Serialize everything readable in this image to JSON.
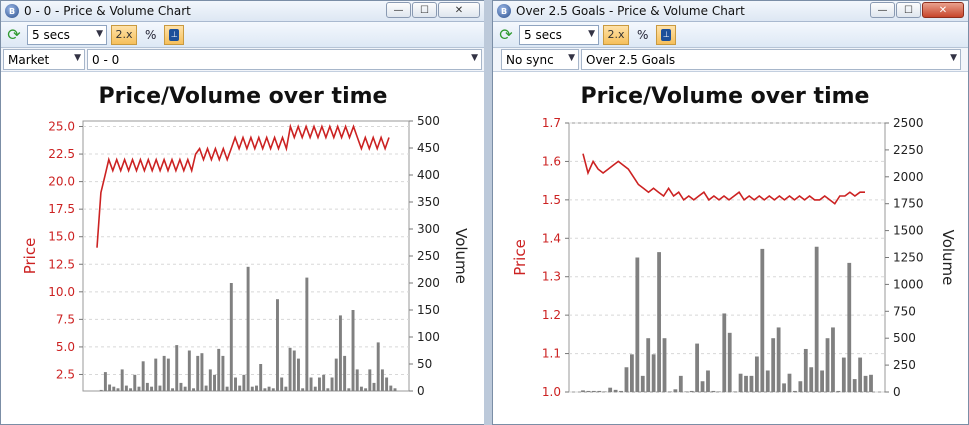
{
  "windows": [
    {
      "title": "0 - 0 - Price & Volume Chart",
      "window_buttons": {
        "minimize": "—",
        "maximize": "☐",
        "close": "✕"
      },
      "close_active": false,
      "toolbar": {
        "refresh_icon": "refresh-icon",
        "interval": "5 secs",
        "zoom": "2.x",
        "percent": "%",
        "pin_icon": "pin-icon"
      },
      "market_select": "Market",
      "runner_select": "0 - 0"
    },
    {
      "title": "Over 2.5 Goals - Price & Volume Chart",
      "window_buttons": {
        "minimize": "—",
        "maximize": "☐",
        "close": "✕"
      },
      "close_active": true,
      "toolbar": {
        "refresh_icon": "refresh-icon",
        "interval": "5 secs",
        "zoom": "2.x",
        "percent": "%",
        "pin_icon": "pin-icon"
      },
      "market_select": "No sync",
      "runner_select": "Over 2.5 Goals"
    }
  ],
  "chart_data": [
    {
      "type": "line+bar",
      "title": "Price/Volume over time",
      "ylabel": "Price",
      "y2label": "Volume",
      "ylim": [
        1.0,
        25.5
      ],
      "yticks": [
        "2.5",
        "5.0",
        "7.5",
        "10.0",
        "12.5",
        "15.0",
        "17.5",
        "20.0",
        "22.5",
        "25.0"
      ],
      "y2lim": [
        0,
        500
      ],
      "y2ticks": [
        "0",
        "50",
        "100",
        "150",
        "200",
        "250",
        "300",
        "350",
        "400",
        "450",
        "500"
      ],
      "price_color": "#cc2222",
      "volume_color": "#808080",
      "price": [
        14,
        19,
        20.5,
        22,
        21,
        22,
        21,
        22,
        21,
        22,
        21,
        22,
        21,
        22,
        21,
        22,
        21,
        22,
        21,
        22,
        21,
        22,
        21,
        22,
        21,
        22.5,
        23,
        22,
        23,
        22,
        23,
        22,
        23,
        22,
        23,
        24,
        23,
        24,
        23,
        24,
        23,
        24,
        23,
        24,
        23,
        24,
        23,
        24,
        23,
        25,
        24,
        25,
        24,
        25,
        24,
        25,
        24,
        25,
        24,
        25,
        24,
        25,
        24,
        25,
        24,
        25,
        24,
        23,
        24,
        23,
        24,
        23,
        24,
        23,
        24
      ],
      "volume": [
        0,
        2,
        35,
        12,
        8,
        5,
        40,
        10,
        5,
        30,
        8,
        55,
        15,
        8,
        60,
        10,
        65,
        60,
        5,
        85,
        15,
        8,
        75,
        5,
        65,
        70,
        10,
        40,
        30,
        78,
        65,
        8,
        200,
        25,
        10,
        30,
        230,
        8,
        10,
        50,
        5,
        8,
        5,
        170,
        25,
        8,
        80,
        75,
        60,
        5,
        210,
        25,
        8,
        25,
        30,
        5,
        25,
        60,
        140,
        65,
        5,
        150,
        40,
        8,
        5,
        40,
        15,
        90,
        40,
        25,
        10,
        5
      ]
    },
    {
      "type": "line+bar",
      "title": "Price/Volume over time",
      "ylabel": "Price",
      "y2label": "Volume",
      "ylim": [
        1.0,
        1.7
      ],
      "yticks": [
        "1.0",
        "1.1",
        "1.2",
        "1.3",
        "1.4",
        "1.5",
        "1.6",
        "1.7"
      ],
      "y2lim": [
        0,
        2500
      ],
      "y2ticks": [
        "0",
        "250",
        "500",
        "750",
        "1000",
        "1250",
        "1500",
        "1750",
        "2000",
        "2250",
        "2500"
      ],
      "price_color": "#cc2222",
      "volume_color": "#808080",
      "price": [
        1.62,
        1.57,
        1.6,
        1.58,
        1.57,
        1.58,
        1.59,
        1.6,
        1.59,
        1.58,
        1.56,
        1.54,
        1.53,
        1.52,
        1.53,
        1.52,
        1.51,
        1.53,
        1.51,
        1.52,
        1.5,
        1.51,
        1.5,
        1.51,
        1.52,
        1.5,
        1.51,
        1.5,
        1.51,
        1.5,
        1.51,
        1.52,
        1.5,
        1.51,
        1.5,
        1.51,
        1.5,
        1.51,
        1.5,
        1.51,
        1.5,
        1.51,
        1.5,
        1.51,
        1.5,
        1.51,
        1.5,
        1.5,
        1.51,
        1.5,
        1.49,
        1.51,
        1.51,
        1.52,
        1.51,
        1.52,
        1.52
      ],
      "volume": [
        15,
        10,
        10,
        10,
        5,
        40,
        20,
        10,
        230,
        350,
        1250,
        150,
        500,
        350,
        1300,
        500,
        5,
        25,
        150,
        5,
        10,
        450,
        100,
        200,
        10,
        5,
        730,
        550,
        5,
        170,
        150,
        150,
        330,
        1330,
        200,
        500,
        600,
        80,
        170,
        10,
        100,
        400,
        230,
        1350,
        200,
        500,
        600,
        10,
        320,
        1200,
        120,
        320,
        150,
        160
      ]
    }
  ]
}
